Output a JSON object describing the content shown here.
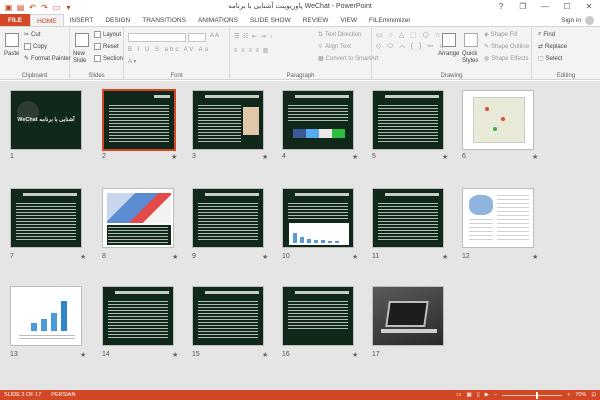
{
  "window": {
    "title": "پاورپوینت آشنایی با برنامه WeChat - PowerPoint",
    "controls": [
      "?",
      "❐",
      "—",
      "☐",
      "✕"
    ]
  },
  "tabs": [
    "FILE",
    "HOME",
    "INSERT",
    "DESIGN",
    "TRANSITIONS",
    "ANIMATIONS",
    "SLIDE SHOW",
    "REVIEW",
    "VIEW",
    "FILEminimizer"
  ],
  "signin": "Sign in",
  "ribbon": {
    "clipboard": {
      "label": "Clipboard",
      "paste": "Paste",
      "cut": "Cut",
      "copy": "Copy",
      "format_painter": "Format Painter"
    },
    "slides": {
      "label": "Slides",
      "new_slide": "New Slide",
      "layout": "Layout",
      "reset": "Reset",
      "section": "Section"
    },
    "font": {
      "label": "Font"
    },
    "paragraph": {
      "label": "Paragraph",
      "text_direction": "Text Direction",
      "align_text": "Align Text",
      "convert_smartart": "Convert to SmartArt"
    },
    "drawing": {
      "label": "Drawing",
      "arrange": "Arrange",
      "quick_styles": "Quick Styles",
      "shape_fill": "Shape Fill",
      "shape_outline": "Shape Outline",
      "shape_effects": "Shape Effects"
    },
    "editing": {
      "label": "Editing",
      "find": "Find",
      "replace": "Replace",
      "select": "Select"
    }
  },
  "slides": [
    {
      "num": "1",
      "star": ""
    },
    {
      "num": "2",
      "star": "★"
    },
    {
      "num": "3",
      "star": "★"
    },
    {
      "num": "4",
      "star": "★"
    },
    {
      "num": "5",
      "star": "★"
    },
    {
      "num": "6",
      "star": "★"
    },
    {
      "num": "7",
      "star": "★"
    },
    {
      "num": "8",
      "star": "★"
    },
    {
      "num": "9",
      "star": "★"
    },
    {
      "num": "10",
      "star": "★"
    },
    {
      "num": "11",
      "star": "★"
    },
    {
      "num": "12",
      "star": "★"
    },
    {
      "num": "13",
      "star": "★"
    },
    {
      "num": "14",
      "star": "★"
    },
    {
      "num": "15",
      "star": "★"
    },
    {
      "num": "16",
      "star": "★"
    },
    {
      "num": "17",
      "star": ""
    }
  ],
  "slide1_title": "WeChat آشنایی با برنامه",
  "status": {
    "slide_of": "SLIDE 2 OF 17",
    "language": "PERSIAN",
    "zoom": "70%"
  },
  "colors": {
    "accent": "#d24726",
    "slide_bg": "#10281a"
  }
}
